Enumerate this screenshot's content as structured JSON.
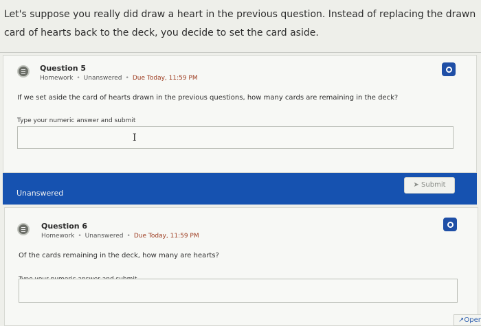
{
  "intro_text": "Let's suppose you really did draw a heart in the previous question. Instead of replacing the drawn card of hearts back to the deck, you decide to set the card aside.",
  "questions": [
    {
      "title": "Question 5",
      "type": "Homework",
      "status": "Unanswered",
      "due": "Due Today, 11:59 PM",
      "text": "If we set aside the card of hearts drawn in the previous questions, how many cards are remaining in the deck?",
      "hint": "Type your numeric answer and submit",
      "answer_value": ""
    },
    {
      "title": "Question 6",
      "type": "Homework",
      "status": "Unanswered",
      "due": "Due Today, 11:59 PM",
      "text": "Of the cards remaining in the deck, how many are hearts?",
      "hint": "Type your numeric answer and submit",
      "answer_value": ""
    }
  ],
  "status_bar": {
    "label": "Unanswered",
    "submit_label": "Submit"
  },
  "open_tab_label": "Open i",
  "colors": {
    "status_bar": "#1652b0",
    "due_text": "#9c3a1e",
    "info_button": "#1f4fa6"
  },
  "icons": {
    "question": "question-list-icon",
    "info": "info-icon",
    "submit": "send-arrow-icon",
    "cursor": "text-cursor-icon",
    "open": "external-arrow-icon"
  }
}
